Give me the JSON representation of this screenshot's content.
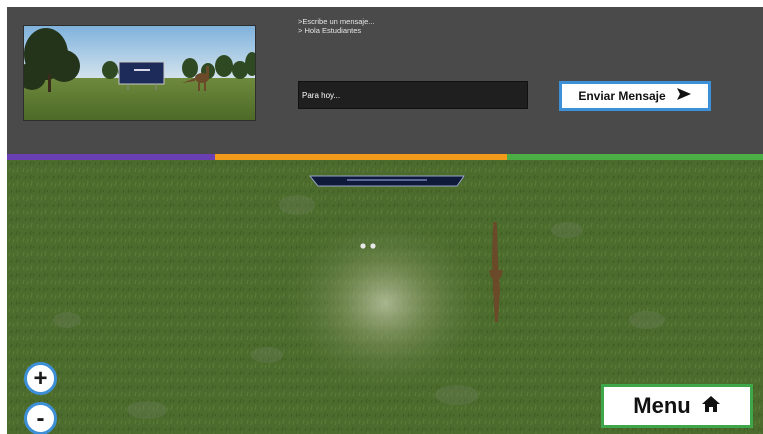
{
  "chat": {
    "messages": [
      ">Escribe un mensaje...",
      "> Hola Estudiantes"
    ],
    "input_value": "Para hoy...",
    "send_label": "Enviar Mensaje",
    "send_icon": "arrow-right-icon"
  },
  "zoom": {
    "in_label": "+",
    "out_label": "-"
  },
  "menu": {
    "label": "Menu",
    "icon": "home-icon"
  },
  "colors": {
    "panel": "#4a4a4a",
    "strip_purple": "#6a3fb3",
    "strip_orange": "#f29a1a",
    "strip_green": "#4caf45",
    "button_border_blue": "#3d8fd8",
    "menu_border_green": "#3fa64a",
    "grass": "#4a6b2c"
  }
}
